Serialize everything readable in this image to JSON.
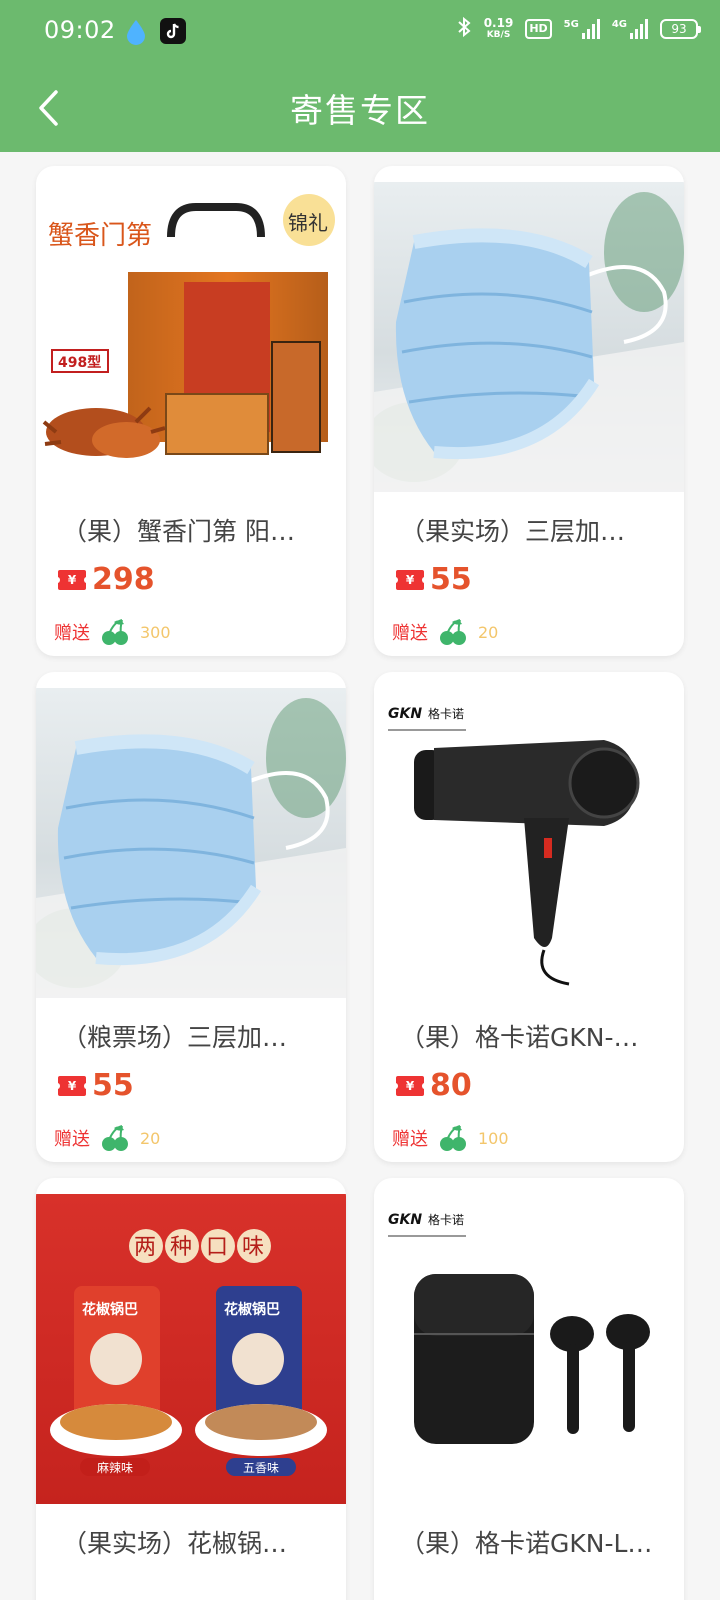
{
  "status_bar": {
    "time": "09:02",
    "net_speed_value": "0.19",
    "net_speed_unit": "KB/S",
    "hd_label": "HD",
    "sig1_label": "5G",
    "sig2_label": "4G",
    "battery": "93"
  },
  "nav": {
    "title": "寄售专区"
  },
  "colors": {
    "header": "#6cba6e",
    "price": "#e5532c",
    "gift_label": "#e33",
    "gift_count": "#f3c66b",
    "cherry": "#3fb56b"
  },
  "products": [
    {
      "name": "（果）蟹香门第 阳…",
      "currency": "¥",
      "price": "298",
      "gift_label": "赠送",
      "gift_icon": "cherry-icon",
      "gift_count": "300",
      "image": "crab-gift-box"
    },
    {
      "name": "（果实场）三层加…",
      "currency": "¥",
      "price": "55",
      "gift_label": "赠送",
      "gift_icon": "cherry-icon",
      "gift_count": "20",
      "image": "face-mask"
    },
    {
      "name": "（粮票场）三层加…",
      "currency": "¥",
      "price": "55",
      "gift_label": "赠送",
      "gift_icon": "cherry-icon",
      "gift_count": "20",
      "image": "face-mask"
    },
    {
      "name": "（果）格卡诺GKN-…",
      "currency": "¥",
      "price": "80",
      "gift_label": "赠送",
      "gift_icon": "cherry-icon",
      "gift_count": "100",
      "image": "hair-dryer"
    },
    {
      "name": "（果实场）花椒锅…",
      "image": "snack-bags"
    },
    {
      "name": "（果）格卡诺GKN-L…",
      "image": "earbuds"
    }
  ],
  "image_text": {
    "crab_brand": "蟹香门第",
    "crab_badge": "498型",
    "crab_seal": "锦礼",
    "gkn_brand": "GKN",
    "gkn_cn": "格卡诺",
    "snack_headline": [
      "两",
      "种",
      "口",
      "味"
    ],
    "snack_flavor_1": "麻辣味",
    "snack_flavor_2": "五香味",
    "snack_bag_label": "花椒锅巴"
  }
}
